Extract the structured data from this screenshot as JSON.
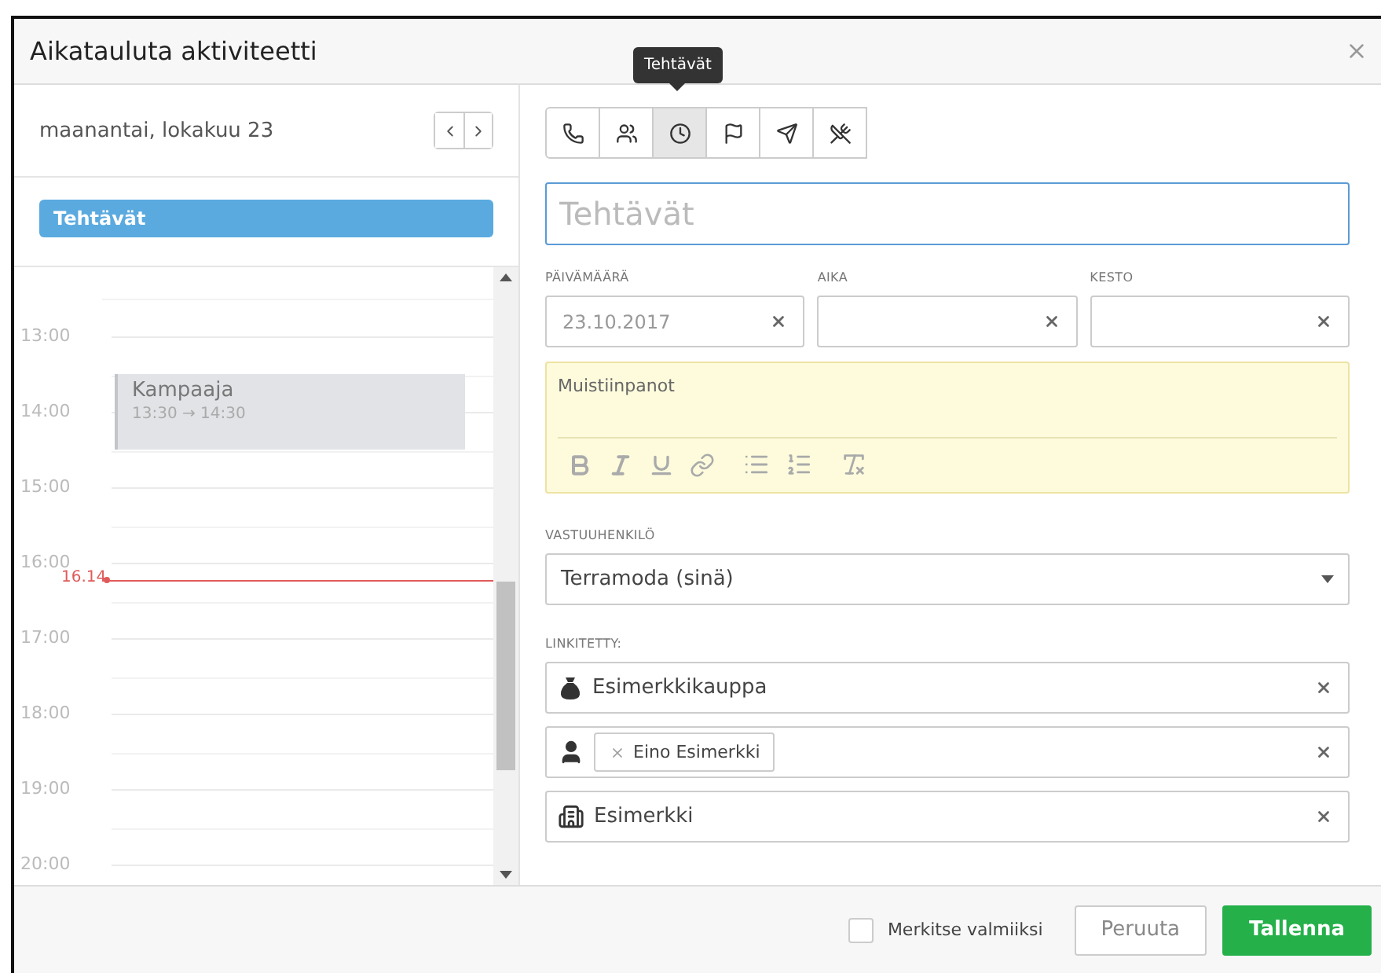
{
  "window": {
    "title": "Aikatauluta aktiviteetti"
  },
  "calendar": {
    "date": "maanantai, lokakuu 23",
    "all_day": [
      {
        "title": "Tehtävät"
      }
    ],
    "hours": [
      "13:00",
      "14:00",
      "15:00",
      "16:00",
      "17:00",
      "18:00",
      "19:00",
      "20:00"
    ],
    "events": [
      {
        "title": "Kampaaja",
        "time": "13:30 → 14:30"
      }
    ],
    "now": "16.14"
  },
  "activity_types": [
    {
      "kind": "call",
      "selected": false
    },
    {
      "kind": "meeting",
      "selected": false
    },
    {
      "kind": "task",
      "selected": true
    },
    {
      "kind": "deadline",
      "selected": false
    },
    {
      "kind": "email",
      "selected": false
    },
    {
      "kind": "lunch",
      "selected": false
    }
  ],
  "tooltip": "Tehtävät",
  "subject": {
    "placeholder": "Tehtävät"
  },
  "fields": [
    {
      "label": "PÄIVÄMÄÄRÄ",
      "value": "23.10.2017"
    },
    {
      "label": "AIKA"
    },
    {
      "label": "KESTO"
    }
  ],
  "notes": {
    "placeholder": "Muistiinpanot"
  },
  "owner": {
    "label": "VASTUUHENKILÖ",
    "value": "Terramoda (sinä)"
  },
  "linked": {
    "label": "LINKITETTY:",
    "items": [
      {
        "kind": "deal",
        "text": "Esimerkkikauppa"
      },
      {
        "kind": "person",
        "tag": "Eino Esimerkki"
      },
      {
        "kind": "organization",
        "text": "Esimerkki"
      }
    ]
  },
  "footer": {
    "done": {
      "label": "Merkitse valmiiksi",
      "checked": false
    },
    "cancel": "Peruuta",
    "save": "Tallenna"
  }
}
